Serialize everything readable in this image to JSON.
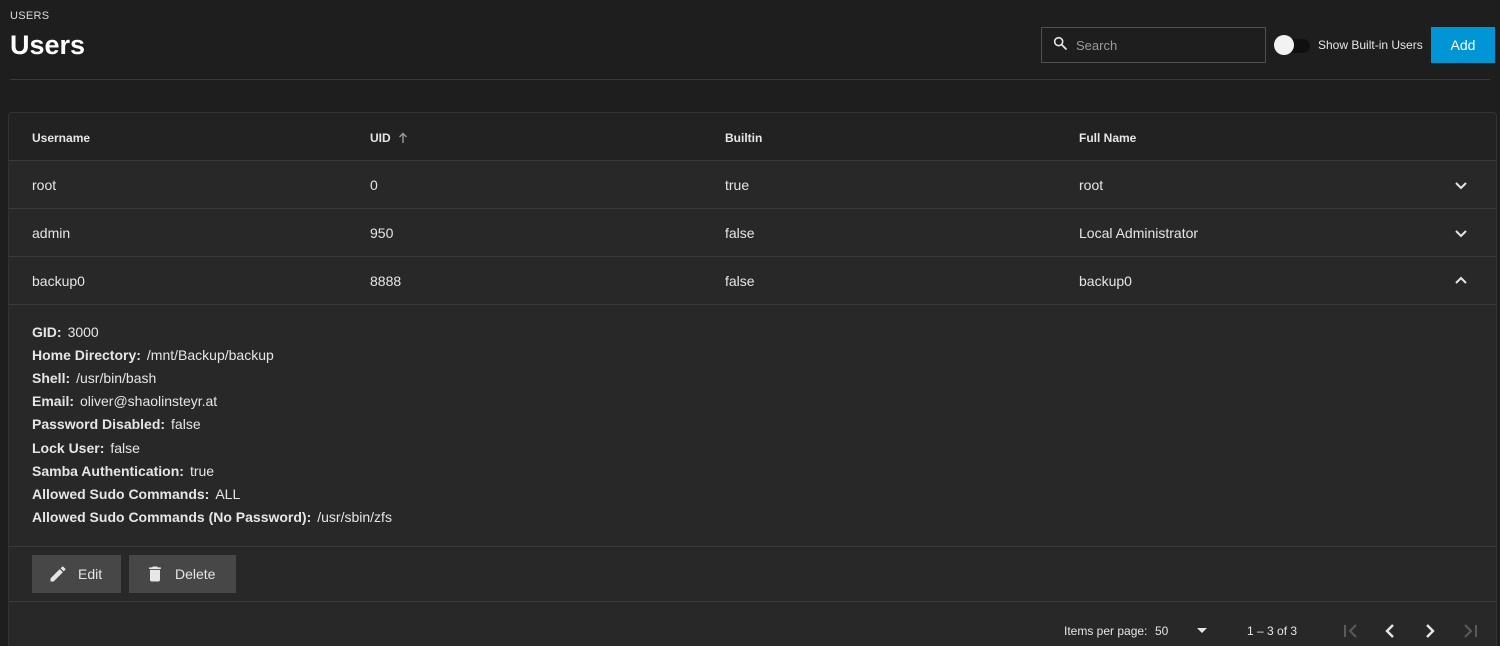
{
  "header": {
    "breadcrumb": "USERS",
    "title": "Users",
    "search_placeholder": "Search",
    "toggle_label": "Show Built-in Users",
    "add_label": "Add"
  },
  "colors": {
    "accent": "#0095d5",
    "background": "#1e1e1e",
    "card": "#282828"
  },
  "table": {
    "columns": [
      "Username",
      "UID",
      "Builtin",
      "Full Name"
    ],
    "sort_column": "UID",
    "sort_direction": "ascending",
    "rows": [
      {
        "username": "root",
        "uid": "0",
        "builtin": "true",
        "full_name": "root",
        "expanded": false
      },
      {
        "username": "admin",
        "uid": "950",
        "builtin": "false",
        "full_name": "Local Administrator",
        "expanded": false
      },
      {
        "username": "backup0",
        "uid": "8888",
        "builtin": "false",
        "full_name": "backup0",
        "expanded": true
      }
    ]
  },
  "details": [
    {
      "label": "GID:",
      "value": "3000"
    },
    {
      "label": "Home Directory:",
      "value": "/mnt/Backup/backup"
    },
    {
      "label": "Shell:",
      "value": "/usr/bin/bash"
    },
    {
      "label": "Email:",
      "value": "oliver@shaolinsteyr.at"
    },
    {
      "label": "Password Disabled:",
      "value": "false"
    },
    {
      "label": "Lock User:",
      "value": "false"
    },
    {
      "label": "Samba Authentication:",
      "value": "true"
    },
    {
      "label": "Allowed Sudo Commands:",
      "value": "ALL"
    },
    {
      "label": "Allowed Sudo Commands (No Password):",
      "value": "/usr/sbin/zfs"
    }
  ],
  "actions": {
    "edit_label": "Edit",
    "delete_label": "Delete"
  },
  "paginator": {
    "items_per_page_label": "Items per page:",
    "page_size": "50",
    "range": "1 – 3 of 3"
  }
}
